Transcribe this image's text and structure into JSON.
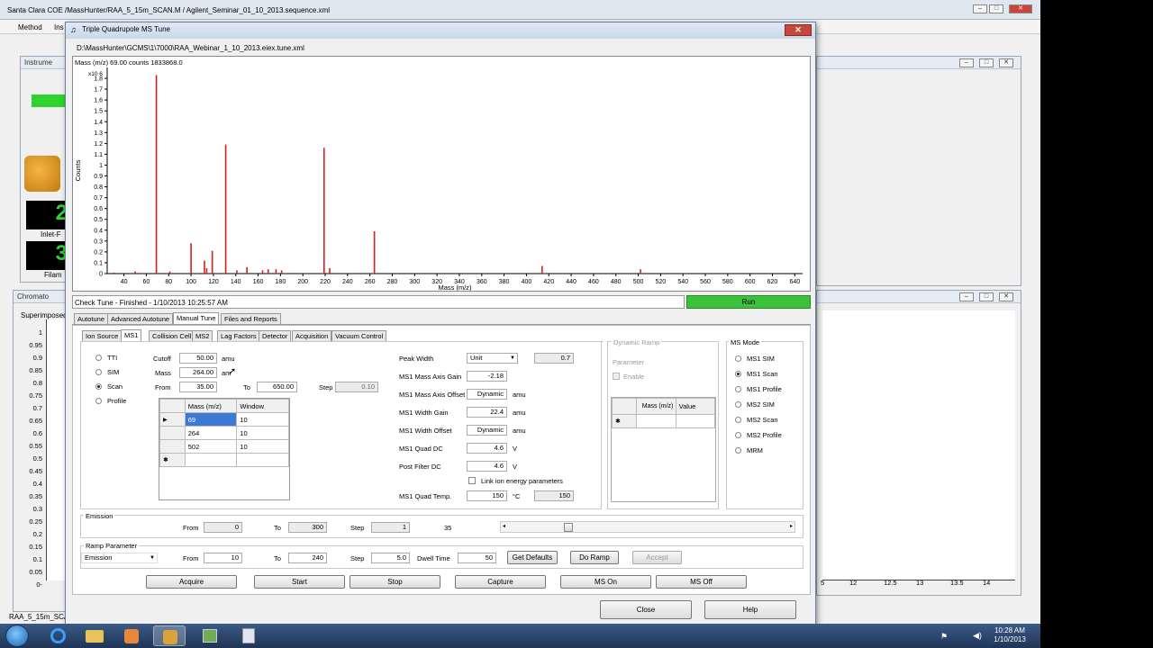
{
  "main_window": {
    "title": "Santa Clara COE /MassHunter/RAA_5_15m_SCAN.M / Agilent_Seminar_01_10_2013.sequence.xml",
    "menu": [
      "Method",
      "Ins"
    ],
    "instrument_tab": "Instrume",
    "inlet_label": "Inlet-F",
    "filament_label": "Filam",
    "digit1": "2",
    "digit2": "3",
    "chromato_title": "Chromato",
    "superimposed_label": "Superimposed",
    "chromato_y_ticks": [
      "1",
      "0.95",
      "0.9",
      "0.85",
      "0.8",
      "0.75",
      "0.7",
      "0.65",
      "0.6",
      "0.55",
      "0.5",
      "0.45",
      "0.4",
      "0.35",
      "0.3",
      "0.25",
      "0.2",
      "0.15",
      "0.1",
      "0.05",
      "0-"
    ],
    "right_x_ticks": [
      "5",
      "12",
      "12.5",
      "13",
      "13.5",
      "14"
    ],
    "status_left": "RAA_5_15m_SCA"
  },
  "dialog": {
    "title": "Triple Quadrupole MS Tune",
    "close_glyph": "✕",
    "file_path": "D:\\MassHunter\\GCMS\\1\\7000\\RAA_Webinar_1_10_2013.eiex.tune.xml",
    "spectrum_header": "Mass (m/z) 69.00 counts 1833868.0",
    "status_text": "Check Tune - Finished - 1/10/2013 10:25:57 AM",
    "run_label": "Run",
    "main_tabs": [
      "Autotune",
      "Advanced Autotune",
      "Manual Tune",
      "Files and Reports"
    ],
    "sub_tabs": [
      "Ion Source",
      "MS1",
      "Collision Cell",
      "MS2",
      "Lag Factors",
      "Detector",
      "Acquisition",
      "Vacuum Control"
    ],
    "scan_modes": [
      "TTI",
      "SIM",
      "Scan",
      "Profile"
    ],
    "cutoff_label": "Cutoff",
    "cutoff_value": "50.00",
    "cutoff_unit": "amu",
    "mass_label": "Mass",
    "mass_value": "264.00",
    "mass_unit": "am",
    "from_label": "From",
    "from_value": "35.00",
    "to_label": "To",
    "to_value": "650.00",
    "step_label": "Step",
    "step_value": "0.10",
    "mass_table": {
      "headers": [
        "Mass (m/z)",
        "Window"
      ],
      "rows": [
        [
          "69",
          "10"
        ],
        [
          "264",
          "10"
        ],
        [
          "502",
          "10"
        ]
      ],
      "current_marker": "▶",
      "new_marker": "✱"
    },
    "params": {
      "peak_width_label": "Peak Width",
      "peak_width_select": "Unit",
      "peak_width_value": "0.7",
      "axis_gain_label": "MS1 Mass Axis Gain",
      "axis_gain_value": "-2.18",
      "axis_offset_label": "MS1 Mass Axis Offset",
      "axis_offset_value": "Dynamic",
      "axis_offset_unit": "amu",
      "width_gain_label": "MS1 Width Gain",
      "width_gain_value": "22.4",
      "width_gain_unit": "amu",
      "width_offset_label": "MS1 Width Offset",
      "width_offset_value": "Dynamic",
      "width_offset_unit": "amu",
      "quad_dc_label": "MS1 Quad DC",
      "quad_dc_value": "4.6",
      "quad_dc_unit": "V",
      "post_filter_label": "Post Filter DC",
      "post_filter_value": "4.6",
      "post_filter_unit": "V",
      "link_label": "Link ion energy parameters",
      "quad_temp_label": "MS1 Quad Temp.",
      "quad_temp_value": "150",
      "quad_temp_unit": "°C",
      "quad_temp_actual": "150"
    },
    "dynamic_ramp": {
      "title": "Dynamic Ramp",
      "parameter_label": "Parameter",
      "enable_label": "Enable",
      "headers": [
        "Mass (m/z)",
        "Value"
      ]
    },
    "ms_mode": {
      "title": "MS Mode",
      "options": [
        "MS1 SIM",
        "MS1 Scan",
        "MS1 Profile",
        "MS2 SIM",
        "MS2 Scan",
        "MS2 Profile",
        "MRM"
      ]
    },
    "emission": {
      "title": "Emission",
      "from_label": "From",
      "from_value": "0",
      "to_label": "To",
      "to_value": "300",
      "step_label": "Step",
      "step_value": "1",
      "extra_value": "35",
      "slider_value": 0.2
    },
    "ramp": {
      "title": "Ramp Parameter",
      "parameter": "Emission",
      "from_label": "From",
      "from_value": "10",
      "to_label": "To",
      "to_value": "240",
      "step_label": "Step",
      "step_value": "5.0",
      "dwell_label": "Dwell Time",
      "dwell_value": "50",
      "get_defaults": "Get Defaults",
      "do_ramp": "Do Ramp",
      "accept": "Accept"
    },
    "actions": [
      "Acquire",
      "Start",
      "Stop",
      "Capture",
      "MS On",
      "MS Off"
    ],
    "close_label": "Close",
    "help_label": "Help"
  },
  "chart_data": {
    "type": "bar",
    "title": "",
    "xlabel": "Mass (m/z)",
    "ylabel": "Counts",
    "y_multiplier": "x10 6",
    "xlim": [
      25,
      647
    ],
    "ylim": [
      0,
      1.9
    ],
    "x_ticks": [
      40,
      60,
      80,
      100,
      120,
      140,
      160,
      180,
      200,
      220,
      240,
      260,
      280,
      300,
      320,
      340,
      360,
      380,
      400,
      420,
      440,
      460,
      480,
      500,
      520,
      540,
      560,
      580,
      600,
      620,
      640
    ],
    "y_ticks": [
      0,
      0.1,
      0.2,
      0.3,
      0.4,
      0.5,
      0.6,
      0.7,
      0.8,
      0.9,
      1,
      1.1,
      1.2,
      1.3,
      1.4,
      1.5,
      1.6,
      1.7,
      1.8
    ],
    "x": [
      31,
      50,
      69,
      81,
      100,
      112,
      114,
      119,
      131,
      141,
      150,
      164,
      169,
      176,
      181,
      219,
      224,
      264,
      414,
      502
    ],
    "values": [
      0.01,
      0.02,
      1.83,
      0.02,
      0.28,
      0.12,
      0.05,
      0.21,
      1.19,
      0.03,
      0.06,
      0.03,
      0.04,
      0.04,
      0.03,
      1.16,
      0.05,
      0.39,
      0.07,
      0.04
    ],
    "color": "#cc2222"
  },
  "taskbar": {
    "time": "10:28 AM",
    "date": "1/10/2013"
  }
}
